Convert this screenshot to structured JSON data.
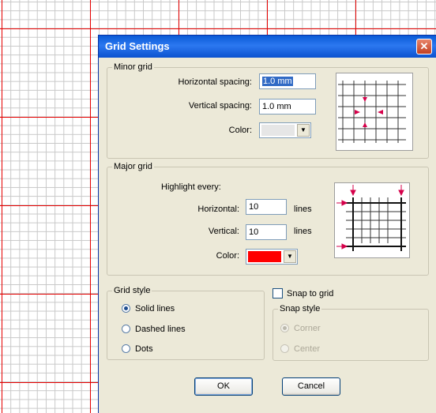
{
  "dialog": {
    "title": "Grid Settings",
    "close_icon": "close-icon"
  },
  "minor_grid": {
    "legend": "Minor grid",
    "horizontal_label": "Horizontal spacing:",
    "horizontal_value": "1.0 mm",
    "vertical_label": "Vertical spacing:",
    "vertical_value": "1.0 mm",
    "color_label": "Color:",
    "color_value": "#e6e6e6",
    "preview_icon": "minor-grid-preview"
  },
  "major_grid": {
    "legend": "Major grid",
    "highlight_label": "Highlight every:",
    "horizontal_label": "Horizontal:",
    "horizontal_value": "10",
    "horizontal_unit": "lines",
    "vertical_label": "Vertical:",
    "vertical_value": "10",
    "vertical_unit": "lines",
    "color_label": "Color:",
    "color_value": "#ff0000",
    "preview_icon": "major-grid-preview"
  },
  "grid_style": {
    "legend": "Grid style",
    "options": [
      {
        "label": "Solid lines",
        "selected": true
      },
      {
        "label": "Dashed lines",
        "selected": false
      },
      {
        "label": "Dots",
        "selected": false
      }
    ]
  },
  "snap": {
    "checkbox_label": "Snap to grid",
    "checked": false,
    "style_legend": "Snap style",
    "options": [
      {
        "label": "Corner",
        "selected": true,
        "enabled": false
      },
      {
        "label": "Center",
        "selected": false,
        "enabled": false
      }
    ]
  },
  "buttons": {
    "ok": "OK",
    "cancel": "Cancel"
  },
  "colors": {
    "canvas_major_line": "#e60000",
    "canvas_minor_line": "#c8c8c8",
    "dialog_bg": "#ece9d8",
    "titlebar": "#0a5bd6",
    "accent_arrow": "#d5004a"
  }
}
